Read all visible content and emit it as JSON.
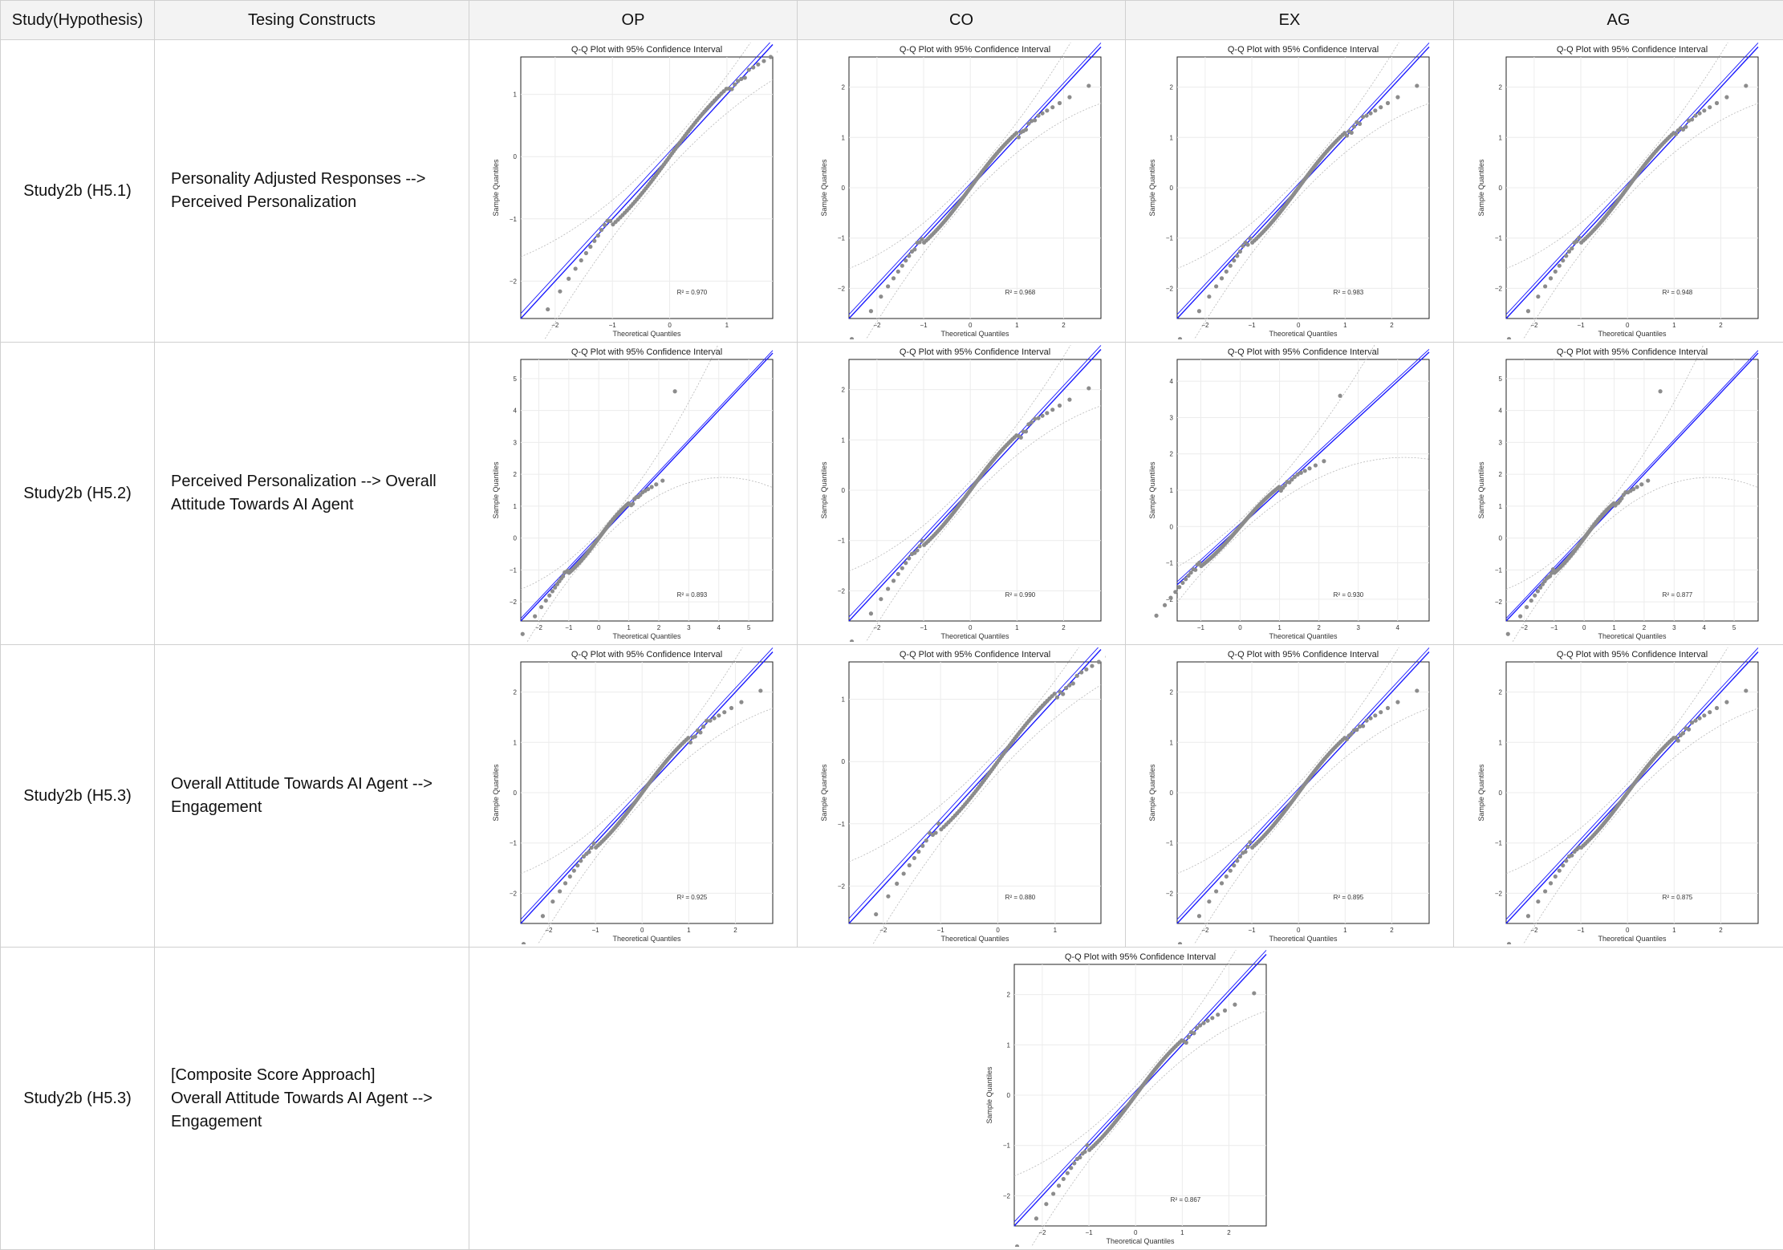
{
  "table": {
    "headers": [
      "Study(Hypothesis)",
      "Tesing Constructs",
      "OP",
      "CO",
      "EX",
      "AG"
    ],
    "rows": [
      {
        "study": "Study2b (H5.1)",
        "construct": [
          "Personality Adjusted Responses -->",
          "Perceived Personalization"
        ],
        "plots": [
          {
            "r2": "R² = 0.970",
            "xticks": [
              "−2",
              "−1",
              "0",
              "1"
            ],
            "yticks": [
              "−2",
              "−1",
              "0",
              "1"
            ]
          },
          {
            "r2": "R² = 0.968",
            "xticks": [
              "−2",
              "−1",
              "0",
              "1",
              "2"
            ],
            "yticks": [
              "−2",
              "−1",
              "0",
              "1",
              "2"
            ]
          },
          {
            "r2": "R² = 0.983",
            "xticks": [
              "−2",
              "−1",
              "0",
              "1",
              "2"
            ],
            "yticks": [
              "−2",
              "−1",
              "0",
              "1",
              "2"
            ]
          },
          {
            "r2": "R² = 0.948",
            "xticks": [
              "−2",
              "−1",
              "0",
              "1",
              "2"
            ],
            "yticks": [
              "−2",
              "−1",
              "0",
              "1",
              "2"
            ]
          }
        ]
      },
      {
        "study": "Study2b (H5.2)",
        "construct": [
          "Perceived Personalization --> Overall",
          "Attitude Towards AI Agent"
        ],
        "plots": [
          {
            "r2": "R² = 0.893",
            "xticks": [
              "−2",
              "−1",
              "0",
              "1",
              "2",
              "3",
              "4",
              "5"
            ],
            "yticks": [
              "−2",
              "−1",
              "0",
              "1",
              "2",
              "3",
              "4",
              "5"
            ]
          },
          {
            "r2": "R² = 0.990",
            "xticks": [
              "−2",
              "−1",
              "0",
              "1",
              "2"
            ],
            "yticks": [
              "−2",
              "−1",
              "0",
              "1",
              "2"
            ]
          },
          {
            "r2": "R² = 0.930",
            "xticks": [
              "−1",
              "0",
              "1",
              "2",
              "3",
              "4"
            ],
            "yticks": [
              "−2",
              "−1",
              "0",
              "1",
              "2",
              "3",
              "4"
            ]
          },
          {
            "r2": "R² = 0.877",
            "xticks": [
              "−2",
              "−1",
              "0",
              "1",
              "2",
              "3",
              "4",
              "5"
            ],
            "yticks": [
              "−2",
              "−1",
              "0",
              "1",
              "2",
              "3",
              "4",
              "5"
            ]
          }
        ]
      },
      {
        "study": "Study2b (H5.3)",
        "construct": [
          "Overall Attitude Towards AI Agent -->",
          "Engagement"
        ],
        "plots": [
          {
            "r2": "R² = 0.925",
            "xticks": [
              "−2",
              "−1",
              "0",
              "1",
              "2"
            ],
            "yticks": [
              "−2",
              "−1",
              "0",
              "1",
              "2"
            ]
          },
          {
            "r2": "R² = 0.880",
            "xticks": [
              "−2",
              "−1",
              "0",
              "1"
            ],
            "yticks": [
              "−2",
              "−1",
              "0",
              "1"
            ]
          },
          {
            "r2": "R² = 0.895",
            "xticks": [
              "−2",
              "−1",
              "0",
              "1",
              "2"
            ],
            "yticks": [
              "−2",
              "−1",
              "0",
              "1",
              "2"
            ]
          },
          {
            "r2": "R² = 0.875",
            "xticks": [
              "−2",
              "−1",
              "0",
              "1",
              "2"
            ],
            "yticks": [
              "−2",
              "−1",
              "0",
              "1",
              "2"
            ]
          }
        ]
      },
      {
        "study": "Study2b (H5.3)",
        "construct": [
          "[Composite Score Approach]",
          "Overall Attitude Towards AI Agent -->",
          "Engagement"
        ],
        "plots": [
          {
            "r2": "R² = 0.867",
            "xticks": [
              "−2",
              "−1",
              "0",
              "1",
              "2"
            ],
            "yticks": [
              "−2",
              "−1",
              "0",
              "1",
              "2"
            ]
          }
        ]
      }
    ]
  },
  "plot_text": {
    "title": "Q-Q Plot with 95% Confidence Interval",
    "xlabel": "Theoretical Quantiles",
    "ylabel": "Sample Quantiles"
  },
  "colors": {
    "reference_line": "#1a1aff",
    "points": "#8c8c8c",
    "confidence_band": "#b8b8b8",
    "header_bg": "#f3f3f3",
    "border": "#d0d0d0"
  }
}
